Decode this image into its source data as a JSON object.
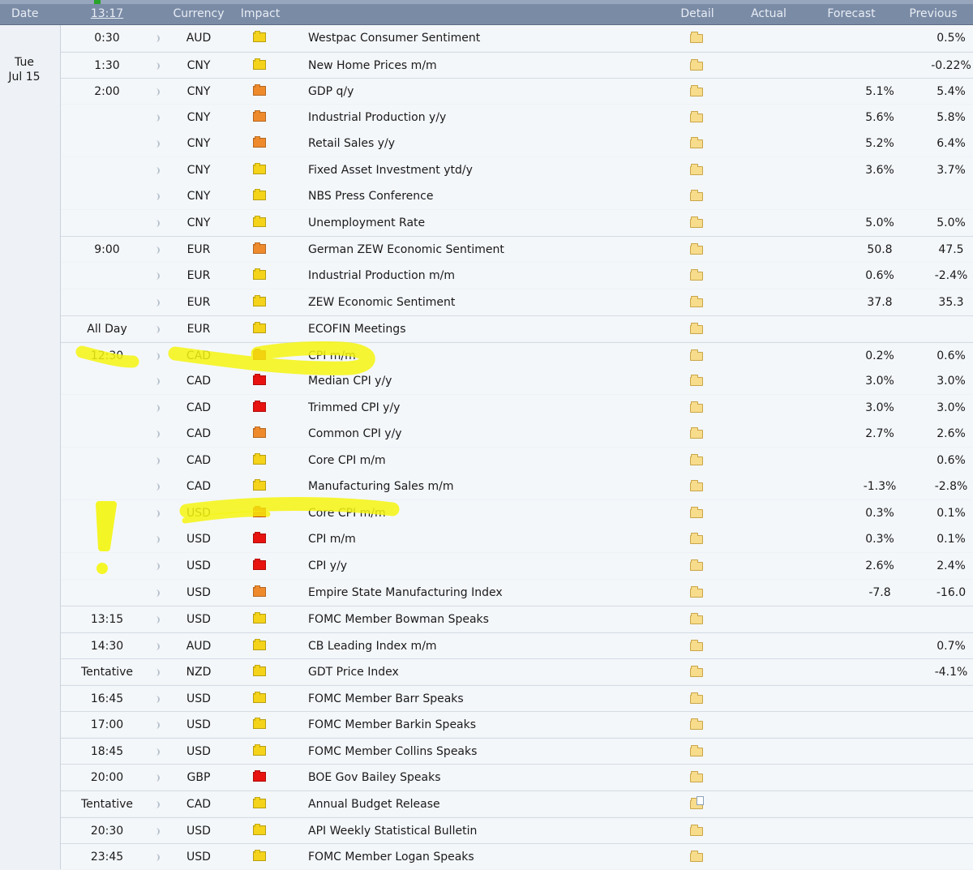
{
  "header": {
    "date": "Date",
    "time": "13:17",
    "currency": "Currency",
    "impact": "Impact",
    "detail": "Detail",
    "actual": "Actual",
    "forecast": "Forecast",
    "previous": "Previous"
  },
  "day": {
    "weekday": "Tue",
    "date": "Jul 15"
  },
  "colors": {
    "high": "#e8120f",
    "medium": "#ef8a2c",
    "low": "#f4d31a",
    "highlighter": "#f5f50f"
  },
  "rows": [
    {
      "time": "0:30",
      "currency": "AUD",
      "impact": "low",
      "event": "Westpac Consumer Sentiment",
      "forecast": "",
      "previous": "0.5%",
      "detail": "folder-icon"
    },
    {
      "time": "1:30",
      "currency": "CNY",
      "impact": "low",
      "event": "New Home Prices m/m",
      "forecast": "",
      "previous": "-0.22%",
      "detail": "folder-icon"
    },
    {
      "time": "2:00",
      "currency": "CNY",
      "impact": "medium",
      "event": "GDP q/y",
      "forecast": "5.1%",
      "previous": "5.4%",
      "detail": "folder-icon"
    },
    {
      "time": "",
      "currency": "CNY",
      "impact": "medium",
      "event": "Industrial Production y/y",
      "forecast": "5.6%",
      "previous": "5.8%",
      "detail": "folder-icon"
    },
    {
      "time": "",
      "currency": "CNY",
      "impact": "medium",
      "event": "Retail Sales y/y",
      "forecast": "5.2%",
      "previous": "6.4%",
      "detail": "folder-icon"
    },
    {
      "time": "",
      "currency": "CNY",
      "impact": "low",
      "event": "Fixed Asset Investment ytd/y",
      "forecast": "3.6%",
      "previous": "3.7%",
      "detail": "folder-icon"
    },
    {
      "time": "",
      "currency": "CNY",
      "impact": "low",
      "event": "NBS Press Conference",
      "forecast": "",
      "previous": "",
      "detail": "folder-icon"
    },
    {
      "time": "",
      "currency": "CNY",
      "impact": "low",
      "event": "Unemployment Rate",
      "forecast": "5.0%",
      "previous": "5.0%",
      "detail": "folder-icon"
    },
    {
      "time": "9:00",
      "currency": "EUR",
      "impact": "medium",
      "event": "German ZEW Economic Sentiment",
      "forecast": "50.8",
      "previous": "47.5",
      "detail": "folder-icon"
    },
    {
      "time": "",
      "currency": "EUR",
      "impact": "low",
      "event": "Industrial Production m/m",
      "forecast": "0.6%",
      "previous": "-2.4%",
      "detail": "folder-icon"
    },
    {
      "time": "",
      "currency": "EUR",
      "impact": "low",
      "event": "ZEW Economic Sentiment",
      "forecast": "37.8",
      "previous": "35.3",
      "detail": "folder-icon"
    },
    {
      "time": "All Day",
      "currency": "EUR",
      "impact": "low",
      "event": "ECOFIN Meetings",
      "forecast": "",
      "previous": "",
      "detail": "folder-icon"
    },
    {
      "time": "12:30",
      "currency": "CAD",
      "impact": "high",
      "event": "CPI m/m",
      "forecast": "0.2%",
      "previous": "0.6%",
      "detail": "folder-icon"
    },
    {
      "time": "",
      "currency": "CAD",
      "impact": "high",
      "event": "Median CPI y/y",
      "forecast": "3.0%",
      "previous": "3.0%",
      "detail": "folder-icon"
    },
    {
      "time": "",
      "currency": "CAD",
      "impact": "high",
      "event": "Trimmed CPI y/y",
      "forecast": "3.0%",
      "previous": "3.0%",
      "detail": "folder-icon"
    },
    {
      "time": "",
      "currency": "CAD",
      "impact": "medium",
      "event": "Common CPI y/y",
      "forecast": "2.7%",
      "previous": "2.6%",
      "detail": "folder-icon"
    },
    {
      "time": "",
      "currency": "CAD",
      "impact": "low",
      "event": "Core CPI m/m",
      "forecast": "",
      "previous": "0.6%",
      "detail": "folder-icon"
    },
    {
      "time": "",
      "currency": "CAD",
      "impact": "low",
      "event": "Manufacturing Sales m/m",
      "forecast": "-1.3%",
      "previous": "-2.8%",
      "detail": "folder-icon"
    },
    {
      "time": "",
      "currency": "USD",
      "impact": "high",
      "event": "Core CPI m/m",
      "forecast": "0.3%",
      "previous": "0.1%",
      "detail": "folder-icon"
    },
    {
      "time": "",
      "currency": "USD",
      "impact": "high",
      "event": "CPI m/m",
      "forecast": "0.3%",
      "previous": "0.1%",
      "detail": "folder-icon"
    },
    {
      "time": "",
      "currency": "USD",
      "impact": "high",
      "event": "CPI y/y",
      "forecast": "2.6%",
      "previous": "2.4%",
      "detail": "folder-icon"
    },
    {
      "time": "",
      "currency": "USD",
      "impact": "medium",
      "event": "Empire State Manufacturing Index",
      "forecast": "-7.8",
      "previous": "-16.0",
      "detail": "folder-icon"
    },
    {
      "time": "13:15",
      "currency": "USD",
      "impact": "low",
      "event": "FOMC Member Bowman Speaks",
      "forecast": "",
      "previous": "",
      "detail": "folder-icon"
    },
    {
      "time": "14:30",
      "currency": "AUD",
      "impact": "low",
      "event": "CB Leading Index m/m",
      "forecast": "",
      "previous": "0.7%",
      "detail": "folder-icon"
    },
    {
      "time": "Tentative",
      "currency": "NZD",
      "impact": "low",
      "event": "GDT Price Index",
      "forecast": "",
      "previous": "-4.1%",
      "detail": "folder-icon"
    },
    {
      "time": "16:45",
      "currency": "USD",
      "impact": "low",
      "event": "FOMC Member Barr Speaks",
      "forecast": "",
      "previous": "",
      "detail": "folder-icon"
    },
    {
      "time": "17:00",
      "currency": "USD",
      "impact": "low",
      "event": "FOMC Member Barkin Speaks",
      "forecast": "",
      "previous": "",
      "detail": "folder-icon"
    },
    {
      "time": "18:45",
      "currency": "USD",
      "impact": "low",
      "event": "FOMC Member Collins Speaks",
      "forecast": "",
      "previous": "",
      "detail": "folder-icon"
    },
    {
      "time": "20:00",
      "currency": "GBP",
      "impact": "high",
      "event": "BOE Gov Bailey Speaks",
      "forecast": "",
      "previous": "",
      "detail": "folder-icon"
    },
    {
      "time": "Tentative",
      "currency": "CAD",
      "impact": "low",
      "event": "Annual Budget Release",
      "forecast": "",
      "previous": "",
      "detail": "folder-doc-icon"
    },
    {
      "time": "20:30",
      "currency": "USD",
      "impact": "low",
      "event": "API Weekly Statistical Bulletin",
      "forecast": "",
      "previous": "",
      "detail": "folder-icon"
    },
    {
      "time": "23:45",
      "currency": "USD",
      "impact": "low",
      "event": "FOMC Member Logan Speaks",
      "forecast": "",
      "previous": "",
      "detail": "folder-icon"
    }
  ]
}
